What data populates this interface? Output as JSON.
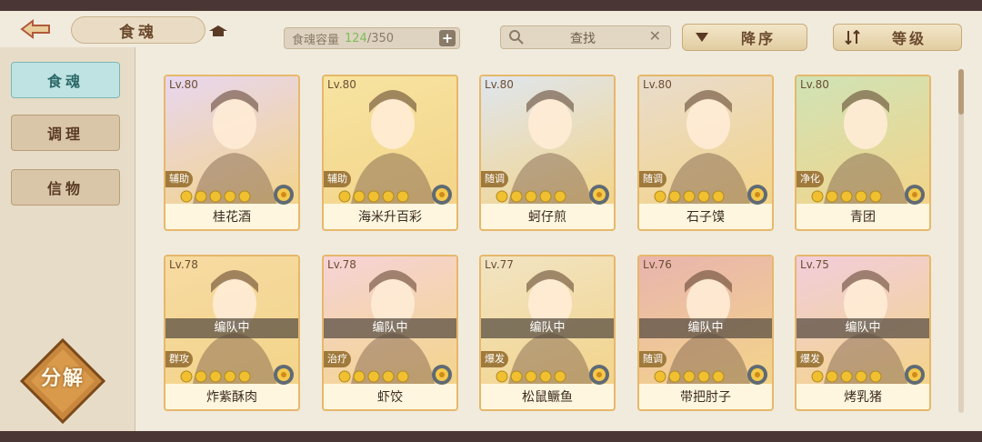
{
  "header": {
    "title": "食魂",
    "capacity_label": "食魂容量",
    "capacity_current": "124",
    "capacity_sep": "/",
    "capacity_max": "350",
    "search_placeholder": "查找",
    "sort_order_label": "降序",
    "sort_by_label": "等级"
  },
  "sidebar": {
    "items": [
      {
        "label": "食魂",
        "active": true
      },
      {
        "label": "调理",
        "active": false
      },
      {
        "label": "信物",
        "active": false
      }
    ],
    "decompose_label": "分解"
  },
  "cards": [
    {
      "level": "Lv.80",
      "role": "辅助",
      "name": "桂花酒",
      "busy": "",
      "color": "#e8d6f0",
      "stars": 5
    },
    {
      "level": "Lv.80",
      "role": "辅助",
      "name": "海米升百彩",
      "busy": "",
      "color": "#f7e4a1",
      "stars": 5
    },
    {
      "level": "Lv.80",
      "role": "随调",
      "name": "蚵仔煎",
      "busy": "",
      "color": "#dfe6ef",
      "stars": 5
    },
    {
      "level": "Lv.80",
      "role": "随调",
      "name": "石子馍",
      "busy": "",
      "color": "#e9dccd",
      "stars": 5
    },
    {
      "level": "Lv.80",
      "role": "净化",
      "name": "青团",
      "busy": "",
      "color": "#cfe3b6",
      "stars": 5
    },
    {
      "level": "Lv.78",
      "role": "群攻",
      "name": "炸紫酥肉",
      "busy": "编队中",
      "color": "#f6dba2",
      "stars": 5
    },
    {
      "level": "Lv.78",
      "role": "治疗",
      "name": "虾饺",
      "busy": "编队中",
      "color": "#f6d3d7",
      "stars": 5
    },
    {
      "level": "Lv.77",
      "role": "爆发",
      "name": "松鼠鳜鱼",
      "busy": "编队中",
      "color": "#f1e4c4",
      "stars": 5
    },
    {
      "level": "Lv.76",
      "role": "随调",
      "name": "带把肘子",
      "busy": "编队中",
      "color": "#e9b4ae",
      "stars": 5
    },
    {
      "level": "Lv.75",
      "role": "爆发",
      "name": "烤乳猪",
      "busy": "编队中",
      "color": "#f2cddc",
      "stars": 5
    }
  ]
}
